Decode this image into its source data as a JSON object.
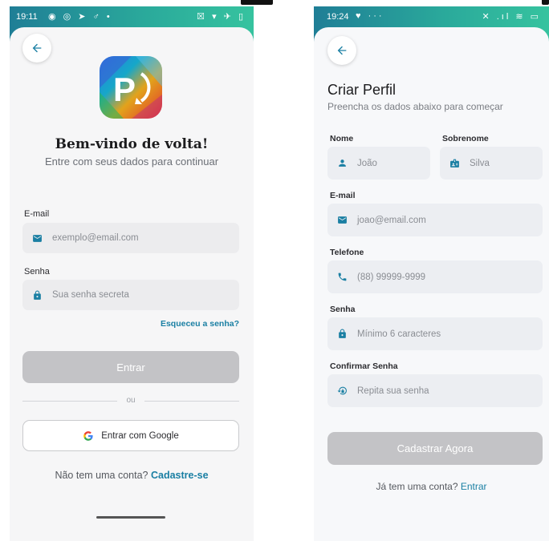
{
  "login": {
    "status": {
      "time": "19:11",
      "left_icons": "◉ ◎ ➤ ♂ •",
      "right_icons": "☒ ▾ ✈ ▯"
    },
    "title": "Bem-vindo de volta!",
    "subtitle": "Entre com seus dados para continuar",
    "email": {
      "label": "E-mail",
      "placeholder": "exemplo@email.com"
    },
    "password": {
      "label": "Senha",
      "placeholder": "Sua senha secreta"
    },
    "forgot_label": "Esqueceu a senha?",
    "submit_label": "Entrar",
    "divider_label": "ou",
    "google_label": "Entrar com Google",
    "no_account_text": "Não tem uma conta?",
    "signup_label": "Cadastre-se"
  },
  "register": {
    "status": {
      "time": "19:24",
      "left_icons": "♥ ···",
      "right_icons": "✕ .ıl ≋ ▭"
    },
    "title": "Criar Perfil",
    "subtitle": "Preencha os dados abaixo para começar",
    "first_name": {
      "label": "Nome",
      "placeholder": "João"
    },
    "last_name": {
      "label": "Sobrenome",
      "placeholder": "Silva"
    },
    "email": {
      "label": "E-mail",
      "placeholder": "joao@email.com"
    },
    "phone": {
      "label": "Telefone",
      "placeholder": "(88) 99999-9999"
    },
    "password": {
      "label": "Senha",
      "placeholder": "Mínimo 6 caracteres"
    },
    "confirm_password": {
      "label": "Confirmar Senha",
      "placeholder": "Repita sua senha"
    },
    "submit_label": "Cadastrar Agora",
    "has_account_text": "Já tem uma conta?",
    "login_label": "Entrar"
  },
  "colors": {
    "accent": "#1a7fa3",
    "disabled_button": "#c3c3c6",
    "status_gradient_start": "#1f7e96",
    "status_gradient_end": "#36c39f"
  },
  "icons": [
    "back-arrow-icon",
    "mail-icon",
    "lock-icon",
    "person-icon",
    "id-badge-icon",
    "phone-icon",
    "lock-reset-icon",
    "google-icon",
    "app-logo"
  ]
}
